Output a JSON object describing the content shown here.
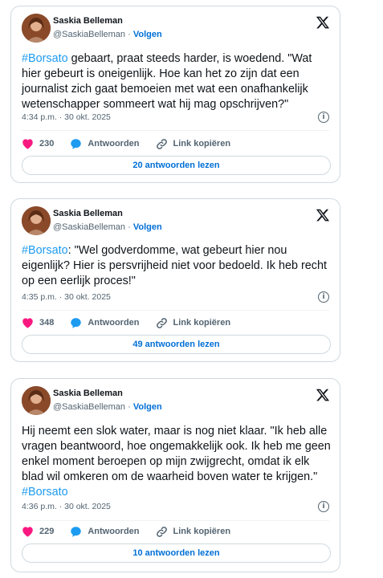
{
  "tweets": [
    {
      "name": "Saskia Belleman",
      "handle": "@SaskiaBelleman",
      "separator": "·",
      "follow": "Volgen",
      "hashtag": "#Borsato",
      "text_before": "",
      "text_after": " gebaart, praat steeds harder, is woedend. \"Wat hier gebeurt is oneigenlijk. Hoe kan het zo zijn dat een journalist zich gaat bemoeien met wat een onafhankelijk wetenschapper sommeert wat hij mag opschrijven?\"",
      "timestamp": "4:34 p.m. · 30 okt. 2025",
      "likes": "230",
      "reply_label": "Antwoorden",
      "copy_label": "Link kopiëren",
      "read_replies": "20 antwoorden lezen"
    },
    {
      "name": "Saskia Belleman",
      "handle": "@SaskiaBelleman",
      "separator": "·",
      "follow": "Volgen",
      "hashtag": "#Borsato",
      "text_before": "",
      "text_after": ": \"Wel godverdomme, wat gebeurt hier nou eigenlijk? Hier is persvrijheid niet voor bedoeld. Ik heb recht op een eerlijk proces!\"",
      "timestamp": "4:35 p.m. · 30 okt. 2025",
      "likes": "348",
      "reply_label": "Antwoorden",
      "copy_label": "Link kopiëren",
      "read_replies": "49 antwoorden lezen"
    },
    {
      "name": "Saskia Belleman",
      "handle": "@SaskiaBelleman",
      "separator": "·",
      "follow": "Volgen",
      "hashtag": "#Borsato",
      "text_before": "Hij neemt een slok water, maar is nog niet klaar. \"Ik heb alle vragen beantwoord, hoe ongemakkelijk ook. Ik heb me geen enkel moment beroepen op mijn zwijgrecht, omdat ik elk blad wil omkeren om de waarheid boven water te krijgen.\" ",
      "text_after": "",
      "timestamp": "4:36 p.m. · 30 okt. 2025",
      "likes": "229",
      "reply_label": "Antwoorden",
      "copy_label": "Link kopiëren",
      "read_replies": "10 antwoorden lezen"
    }
  ],
  "icons": {
    "like": "heart-icon",
    "reply": "speech-bubble-icon",
    "copy": "link-icon",
    "brand": "x-logo-icon",
    "info": "info-icon"
  },
  "colors": {
    "accent": "#1d9bf0",
    "link": "#006fd6",
    "like": "#f91880",
    "muted": "#536471",
    "border": "#cfd9de"
  }
}
